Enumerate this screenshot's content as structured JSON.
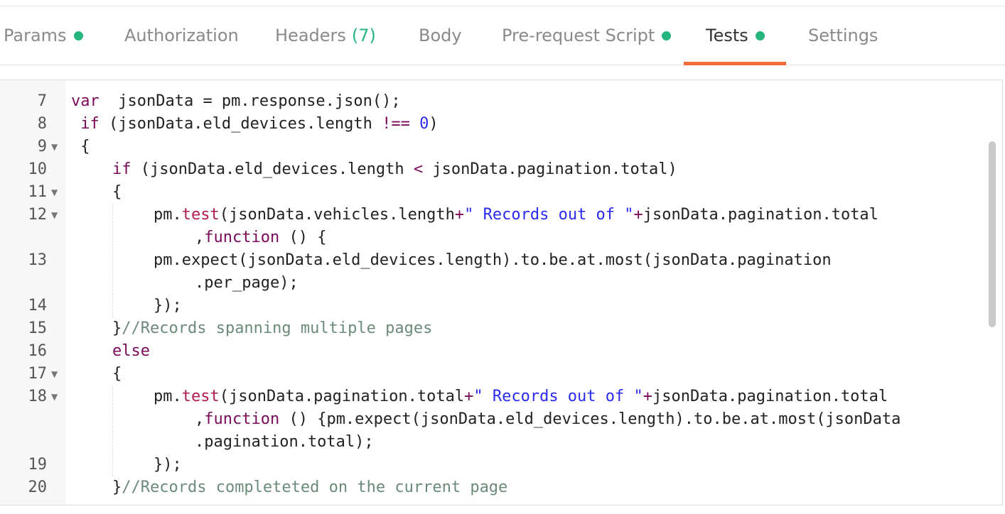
{
  "tabs": [
    {
      "label": "Params",
      "dot": true
    },
    {
      "label": "Authorization"
    },
    {
      "label": "Headers",
      "count": "(7)"
    },
    {
      "label": "Body"
    },
    {
      "label": "Pre-request Script",
      "dot": true
    },
    {
      "label": "Tests",
      "dot": true,
      "active": true
    },
    {
      "label": "Settings"
    }
  ],
  "colors": {
    "accent": "#f26b3a",
    "dot": "#26b47f"
  },
  "icons": {
    "fold": "chevron-down-icon",
    "status": "green-dot-icon"
  },
  "editor": {
    "lines": [
      {
        "num": "7",
        "fold": false,
        "indent": 0,
        "tokens": [
          [
            "kw",
            "var"
          ],
          [
            "",
            "  jsonData = pm.response.json();"
          ]
        ]
      },
      {
        "num": "8",
        "fold": false,
        "indent": 0,
        "tokens": [
          [
            "kw",
            " if"
          ],
          [
            "",
            " (jsonData.eld_devices.length "
          ],
          [
            "kw",
            "!=="
          ],
          [
            "num",
            " 0"
          ],
          [
            "",
            ")"
          ]
        ]
      },
      {
        "num": "9",
        "fold": true,
        "indent": 0,
        "tokens": [
          [
            "",
            " {"
          ]
        ]
      },
      {
        "num": "10",
        "fold": false,
        "indent": 1,
        "tokens": [
          [
            "kw",
            "if"
          ],
          [
            "",
            " (jsonData.eld_devices.length "
          ],
          [
            "kw",
            "<"
          ],
          [
            "",
            " jsonData.pagination.total)"
          ]
        ]
      },
      {
        "num": "11",
        "fold": true,
        "indent": 1,
        "tokens": [
          [
            "",
            "{"
          ]
        ]
      },
      {
        "num": "12",
        "fold": true,
        "indent": 2,
        "tokens": [
          [
            "",
            "pm."
          ],
          [
            "fn",
            "test"
          ],
          [
            "",
            "(jsonData.vehicles.length"
          ],
          [
            "kw",
            "+"
          ],
          [
            "str",
            "\" Records out of \""
          ],
          [
            "kw",
            "+"
          ],
          [
            "",
            "jsonData.pagination.total"
          ]
        ]
      },
      {
        "num": "",
        "fold": false,
        "indent": 3,
        "tokens": [
          [
            "",
            ","
          ],
          [
            "kw",
            "function"
          ],
          [
            "",
            " () {"
          ]
        ]
      },
      {
        "num": "13",
        "fold": false,
        "indent": 2,
        "tokens": [
          [
            "",
            "pm.expect(jsonData.eld_devices.length).to.be.at.most(jsonData.pagination"
          ]
        ]
      },
      {
        "num": "",
        "fold": false,
        "indent": 3,
        "tokens": [
          [
            "",
            ".per_page);"
          ]
        ]
      },
      {
        "num": "14",
        "fold": false,
        "indent": 2,
        "tokens": [
          [
            "",
            "});"
          ]
        ]
      },
      {
        "num": "15",
        "fold": false,
        "indent": 1,
        "tokens": [
          [
            "",
            "}"
          ],
          [
            "cm",
            "//Records spanning multiple pages"
          ]
        ]
      },
      {
        "num": "16",
        "fold": false,
        "indent": 1,
        "tokens": [
          [
            "kw",
            "else"
          ]
        ]
      },
      {
        "num": "17",
        "fold": true,
        "indent": 1,
        "tokens": [
          [
            "",
            "{"
          ]
        ]
      },
      {
        "num": "18",
        "fold": true,
        "indent": 2,
        "tokens": [
          [
            "",
            "pm."
          ],
          [
            "fn",
            "test"
          ],
          [
            "",
            "(jsonData.pagination.total"
          ],
          [
            "kw",
            "+"
          ],
          [
            "str",
            "\" Records out of \""
          ],
          [
            "kw",
            "+"
          ],
          [
            "",
            "jsonData.pagination.total"
          ]
        ]
      },
      {
        "num": "",
        "fold": false,
        "indent": 3,
        "tokens": [
          [
            "",
            ","
          ],
          [
            "kw",
            "function"
          ],
          [
            "",
            " () {pm.expect(jsonData.eld_devices.length).to.be.at.most(jsonData"
          ]
        ]
      },
      {
        "num": "",
        "fold": false,
        "indent": 3,
        "tokens": [
          [
            "",
            ".pagination.total);"
          ]
        ]
      },
      {
        "num": "19",
        "fold": false,
        "indent": 2,
        "tokens": [
          [
            "",
            "});"
          ]
        ]
      },
      {
        "num": "20",
        "fold": false,
        "indent": 1,
        "tokens": [
          [
            "",
            "}"
          ],
          [
            "cm",
            "//Records completeted on the current page"
          ]
        ]
      }
    ]
  }
}
